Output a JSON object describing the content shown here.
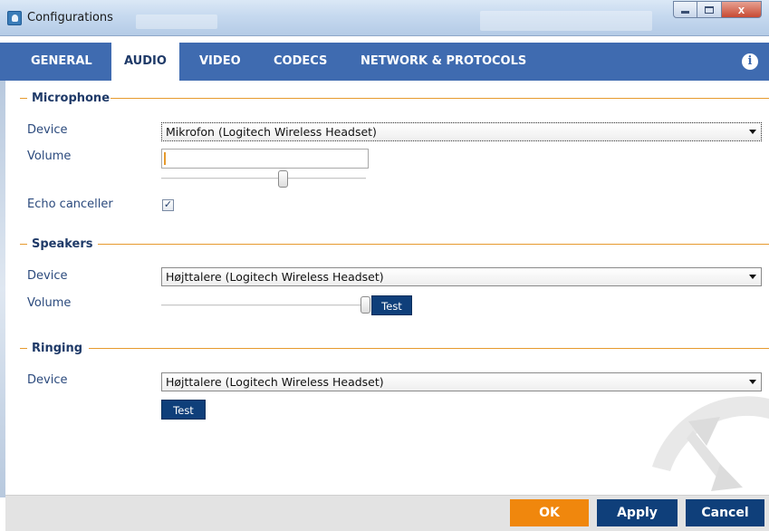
{
  "window": {
    "title": "Configurations",
    "close_glyph": "x"
  },
  "tabs": [
    {
      "label": "GENERAL",
      "active": false
    },
    {
      "label": "AUDIO",
      "active": true
    },
    {
      "label": "VIDEO",
      "active": false
    },
    {
      "label": "CODECS",
      "active": false
    },
    {
      "label": "NETWORK & PROTOCOLS",
      "active": false
    }
  ],
  "info_icon_glyph": "i",
  "microphone": {
    "heading": "Microphone",
    "device_label": "Device",
    "device_value": "Mikrofon (Logitech Wireless Headset)",
    "volume_label": "Volume",
    "volume_level": 0.6,
    "echo_label": "Echo canceller",
    "echo_checked": true,
    "check_glyph": "✓"
  },
  "speakers": {
    "heading": "Speakers",
    "device_label": "Device",
    "device_value": "Højttalere (Logitech Wireless Headset)",
    "volume_label": "Volume",
    "volume_level": 1.0,
    "test_label": "Test"
  },
  "ringing": {
    "heading": "Ringing",
    "device_label": "Device",
    "device_value": "Højttalere (Logitech Wireless Headset)",
    "test_label": "Test"
  },
  "footer": {
    "ok_label": "OK",
    "apply_label": "Apply",
    "cancel_label": "Cancel"
  },
  "colors": {
    "tab_bar": "#3f6bb0",
    "accent_orange": "#f0870d",
    "dark_navy": "#0f3f7a",
    "section_line": "#e69a2e"
  }
}
